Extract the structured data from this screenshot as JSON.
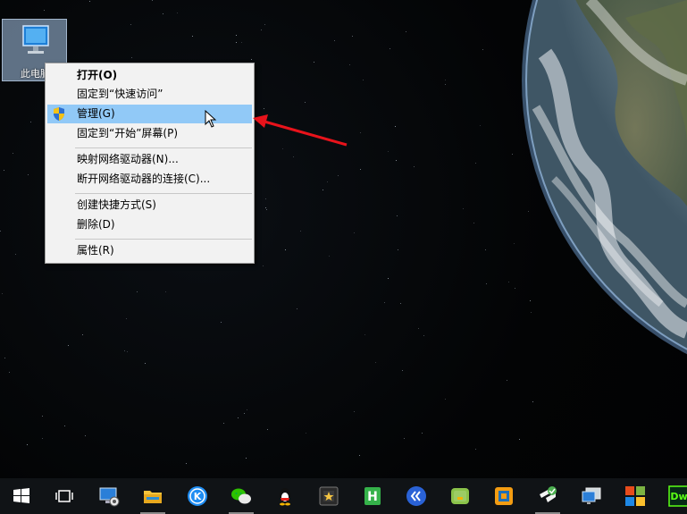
{
  "desktop": {
    "icon_label": "此电脑"
  },
  "context_menu": {
    "items": [
      {
        "label": "打开(O)",
        "bold": true
      },
      {
        "label": "固定到“快速访问”"
      },
      {
        "label": "管理(G)",
        "highlighted": true,
        "icon": "uac-shield-icon"
      },
      {
        "label": "固定到“开始”屏幕(P)"
      },
      {
        "label": "映射网络驱动器(N)..."
      },
      {
        "label": "断开网络驱动器的连接(C)..."
      },
      {
        "label": "创建快捷方式(S)"
      },
      {
        "label": "删除(D)"
      },
      {
        "label": "属性(R)"
      }
    ]
  },
  "annotation": {
    "arrow_color": "#e8131b"
  },
  "colors": {
    "menu_highlight": "#91c9f7",
    "menu_bg": "#f2f2f2",
    "taskbar_bg": "#101316"
  },
  "taskbar": {
    "items": [
      {
        "name": "start-icon"
      },
      {
        "name": "task-view-icon"
      },
      {
        "name": "control-panel-icon"
      },
      {
        "name": "file-explorer-icon"
      },
      {
        "name": "kugou-music-icon"
      },
      {
        "name": "wechat-icon"
      },
      {
        "name": "qq-icon"
      },
      {
        "name": "app-launcher-icon"
      },
      {
        "name": "hbuilder-icon"
      },
      {
        "name": "browser-icon"
      },
      {
        "name": "android-emulator-icon"
      },
      {
        "name": "virtual-machine-icon"
      },
      {
        "name": "sublime-icon"
      },
      {
        "name": "remote-desktop-icon"
      },
      {
        "name": "office-icon"
      },
      {
        "name": "dreamweaver-icon",
        "text": "Dw"
      }
    ]
  }
}
